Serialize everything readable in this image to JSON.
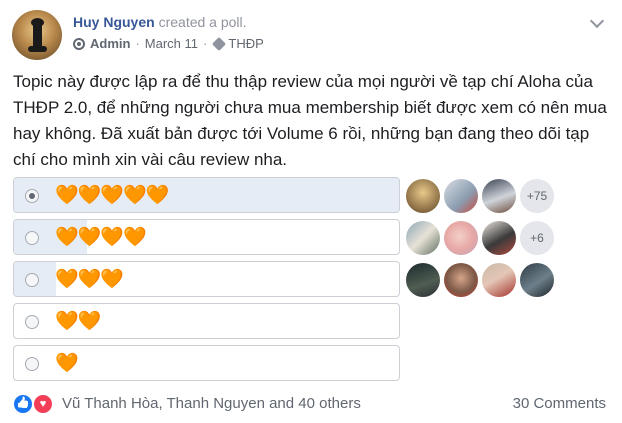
{
  "post": {
    "author": "Huy Nguyen",
    "action": "created a poll.",
    "role": "Admin",
    "date": "March 11",
    "topic": "THĐP",
    "body": "Topic này được lập ra để thu thập review của mọi người về tạp chí Aloha của THĐP 2.0, để những người chưa mua membership biết được xem có nên mua hay không. Đã xuất bản được tới Volume 6 rồi, những bạn đang theo dõi tạp chí cho mình xin vài câu review nha."
  },
  "poll": {
    "options": [
      {
        "label": "🧡🧡🧡🧡🧡",
        "selected": true,
        "fill": 1.0,
        "more": "+75"
      },
      {
        "label": "🧡🧡🧡🧡",
        "selected": false,
        "fill": 0.19,
        "more": "+6"
      },
      {
        "label": "🧡🧡🧡",
        "selected": false,
        "fill": 0.11,
        "more": ""
      },
      {
        "label": "🧡🧡",
        "selected": false,
        "fill": 0.0,
        "more": ""
      },
      {
        "label": "🧡",
        "selected": false,
        "fill": 0.0,
        "more": ""
      }
    ]
  },
  "footer": {
    "reactors": "Vũ Thanh Hòa, Thanh Nguyen and 40 others",
    "comments": "30 Comments"
  },
  "colors": {
    "link": "#385898",
    "heart": "#f7931e",
    "fill": "#e6ecf5",
    "like": "#1877f2",
    "love": "#f33e58"
  },
  "icons": [
    "admin-icon",
    "tag-icon",
    "chevron-down-icon",
    "like-icon",
    "love-icon",
    "radio-icon"
  ]
}
